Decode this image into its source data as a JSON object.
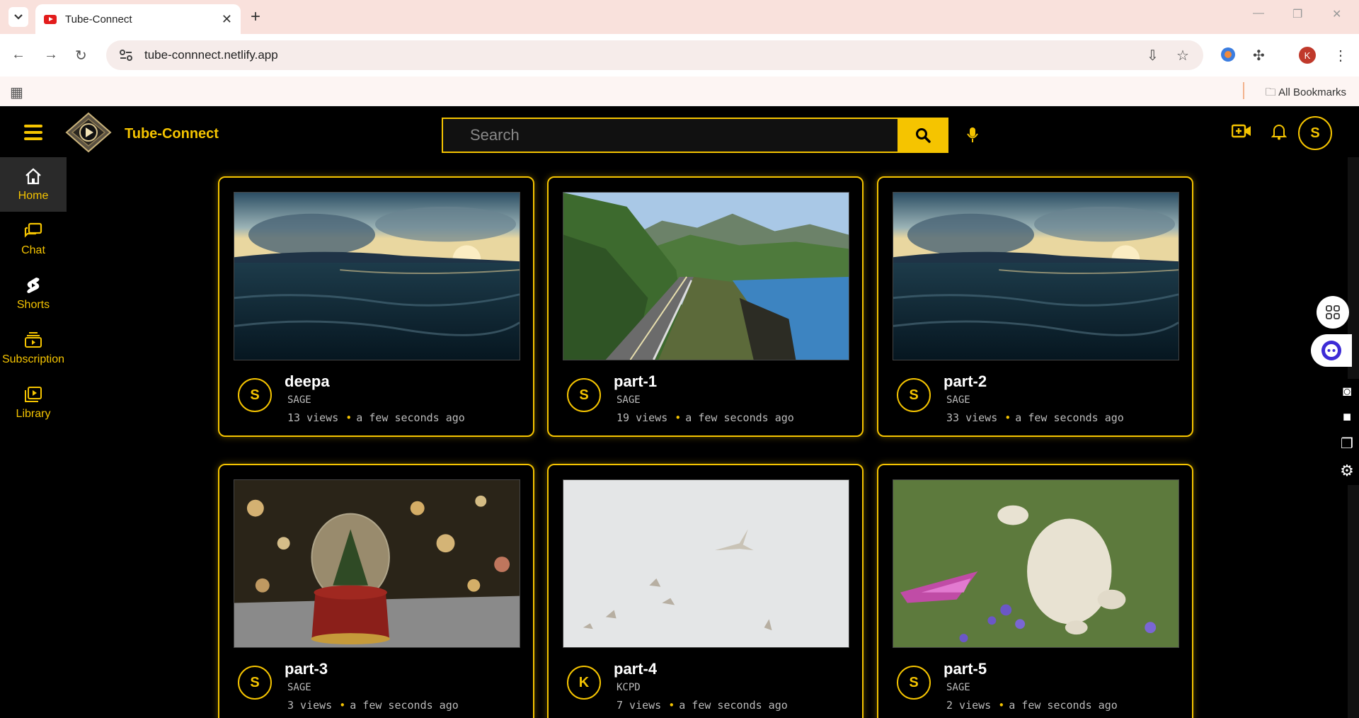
{
  "browser": {
    "tab_title": "Tube-Connect",
    "url": "tube-connnect.netlify.app",
    "profile_initial": "K",
    "bookmarks_label": "All Bookmarks"
  },
  "app": {
    "brand": "Tube-Connect",
    "search_placeholder": "Search",
    "user_initial": "S",
    "accent_color": "#f5c400"
  },
  "sidebar": {
    "items": [
      {
        "label": "Home",
        "icon": "home-icon",
        "active": true
      },
      {
        "label": "Chat",
        "icon": "chat-icon"
      },
      {
        "label": "Shorts",
        "icon": "shorts-icon"
      },
      {
        "label": "Subscription",
        "icon": "subscription-icon"
      },
      {
        "label": "Library",
        "icon": "library-icon"
      }
    ]
  },
  "videos": [
    {
      "title": "deepa",
      "channel": "SAGE",
      "avatar": "S",
      "views": "13 views",
      "time": "a few seconds ago",
      "thumb": "ocean-sunset"
    },
    {
      "title": "part-1",
      "channel": "SAGE",
      "avatar": "S",
      "views": "19 views",
      "time": "a few seconds ago",
      "thumb": "coastal-road"
    },
    {
      "title": "part-2",
      "channel": "SAGE",
      "avatar": "S",
      "views": "33 views",
      "time": "a few seconds ago",
      "thumb": "ocean-sunset"
    },
    {
      "title": "part-3",
      "channel": "SAGE",
      "avatar": "S",
      "views": "3 views",
      "time": "a few seconds ago",
      "thumb": "snow-globe"
    },
    {
      "title": "part-4",
      "channel": "KCPD",
      "avatar": "K",
      "views": "7 views",
      "time": "a few seconds ago",
      "thumb": "seagulls"
    },
    {
      "title": "part-5",
      "channel": "SAGE",
      "avatar": "S",
      "views": "2 views",
      "time": "a few seconds ago",
      "thumb": "bunny-meadow"
    }
  ]
}
